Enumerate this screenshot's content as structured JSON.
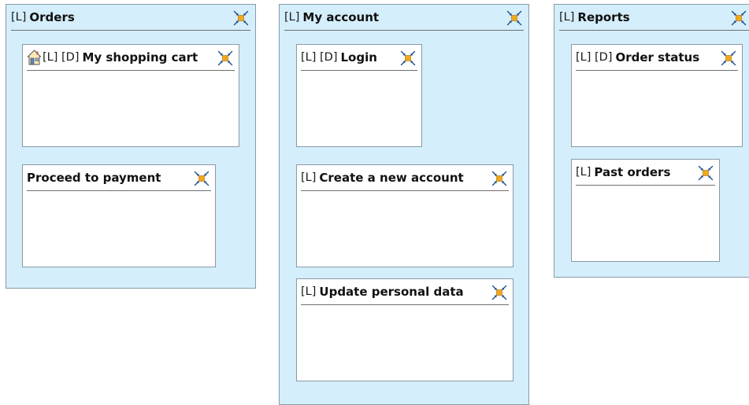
{
  "groups": [
    {
      "prefix": "[L]",
      "title": "Orders",
      "cards": [
        {
          "home_icon": "home-icon",
          "prefix": "[L] [D]",
          "title": "My shopping cart"
        },
        {
          "prefix": "",
          "title": "Proceed to payment"
        }
      ]
    },
    {
      "prefix": "[L]",
      "title": "My account",
      "cards": [
        {
          "prefix": "[L] [D]",
          "title": "Login"
        },
        {
          "prefix": "[L]",
          "title": "Create a new account"
        },
        {
          "prefix": "[L]",
          "title": "Update personal data"
        }
      ]
    },
    {
      "prefix": "[L]",
      "title": "Reports",
      "cards": [
        {
          "prefix": "[L] [D]",
          "title": "Order status"
        },
        {
          "prefix": "[L]",
          "title": "Past orders"
        }
      ]
    }
  ],
  "icons": {
    "collapse": "collapse-arrows-icon",
    "home": "home-icon"
  },
  "colors": {
    "group_fill": "#d4eefb",
    "card_fill": "#ffffff",
    "border": "#8a9aa6",
    "icon_accent": "#f0a81e",
    "icon_arrow": "#1f4e8c"
  }
}
